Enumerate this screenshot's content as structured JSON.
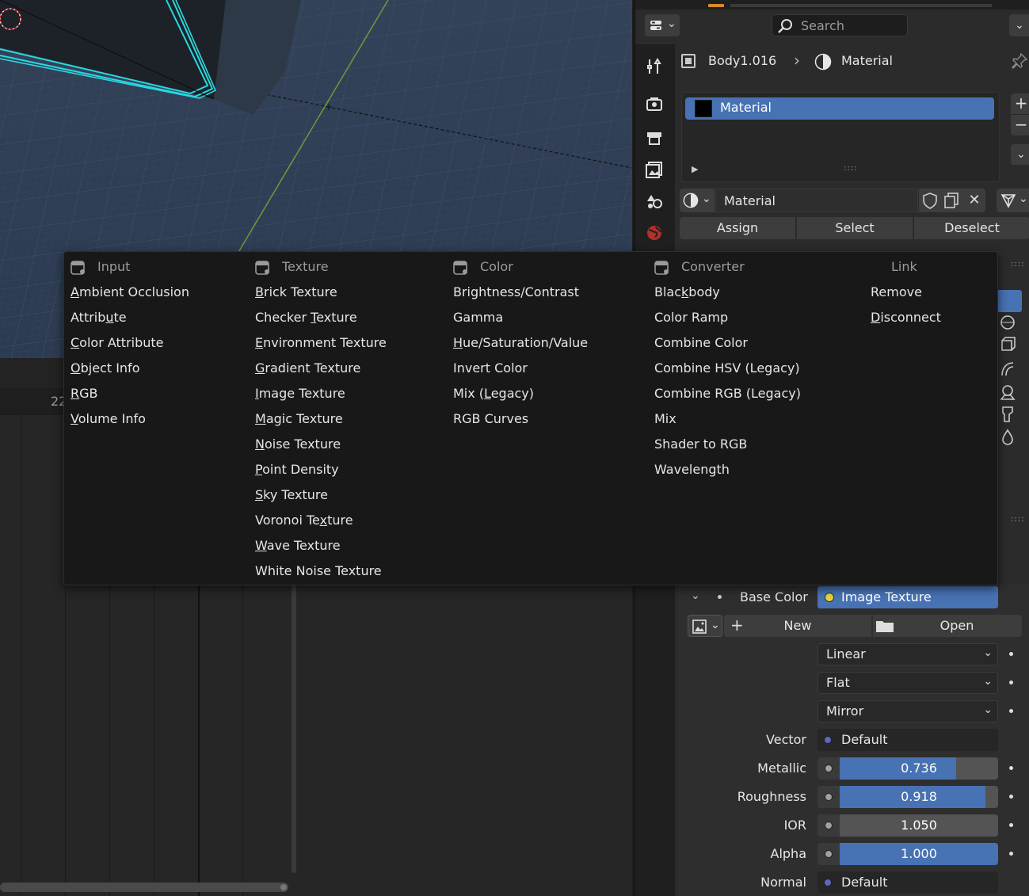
{
  "properties": {
    "search": {
      "placeholder": "Search"
    },
    "breadcrumb": {
      "object": "Body1.016",
      "material": "Material"
    },
    "material_slots": [
      {
        "label": "Material"
      }
    ],
    "material_datablock": {
      "name": "Material"
    },
    "edit_buttons": {
      "assign": "Assign",
      "select": "Select",
      "deselect": "Deselect"
    },
    "surface": {
      "base_color": {
        "label": "Base Color",
        "link": "Image Texture"
      },
      "image": {
        "new_label": "New",
        "open_label": "Open"
      },
      "interpolation": "Linear",
      "projection": "Flat",
      "extension": "Mirror",
      "vector": {
        "label": "Vector",
        "value": "Default"
      },
      "metallic": {
        "label": "Metallic",
        "value": "0.736",
        "fraction": 0.736
      },
      "roughness": {
        "label": "Roughness",
        "value": "0.918",
        "fraction": 0.918
      },
      "ior": {
        "label": "IOR",
        "value": "1.050",
        "fraction": 0.0
      },
      "alpha": {
        "label": "Alpha",
        "value": "1.000",
        "fraction": 1.0
      },
      "normal": {
        "label": "Normal",
        "value": "Default"
      }
    },
    "socket_colors": {
      "float": "#a1a1a1",
      "vector": "#6363c7",
      "color": "#c7c729"
    }
  },
  "timeline": {
    "frame_label": "22"
  },
  "add_menu": {
    "columns": [
      {
        "header": "Input",
        "icon": "node-menu-icon",
        "items": [
          {
            "pre": "",
            "key": "A",
            "post": "mbient Occlusion"
          },
          {
            "pre": "Attrib",
            "key": "u",
            "post": "te"
          },
          {
            "pre": "",
            "key": "C",
            "post": "olor Attribute"
          },
          {
            "pre": "",
            "key": "O",
            "post": "bject Info"
          },
          {
            "pre": "",
            "key": "R",
            "post": "GB"
          },
          {
            "pre": "",
            "key": "V",
            "post": "olume Info"
          }
        ]
      },
      {
        "header": "Texture",
        "icon": "node-menu-icon",
        "items": [
          {
            "pre": "",
            "key": "B",
            "post": "rick Texture"
          },
          {
            "pre": "Checker ",
            "key": "T",
            "post": "exture"
          },
          {
            "pre": "",
            "key": "E",
            "post": "nvironment Texture"
          },
          {
            "pre": "",
            "key": "G",
            "post": "radient Texture"
          },
          {
            "pre": "",
            "key": "I",
            "post": "mage Texture"
          },
          {
            "pre": "",
            "key": "M",
            "post": "agic Texture"
          },
          {
            "pre": "",
            "key": "N",
            "post": "oise Texture"
          },
          {
            "pre": "",
            "key": "P",
            "post": "oint Density"
          },
          {
            "pre": "",
            "key": "S",
            "post": "ky Texture"
          },
          {
            "pre": "Voronoi Te",
            "key": "x",
            "post": "ture"
          },
          {
            "pre": "",
            "key": "W",
            "post": "ave Texture"
          },
          {
            "pre": "White Noise Texture",
            "key": "",
            "post": ""
          }
        ]
      },
      {
        "header": "Color",
        "icon": "node-menu-icon",
        "items": [
          {
            "pre": "Brightness/Contrast",
            "key": "",
            "post": ""
          },
          {
            "pre": "Gamma",
            "key": "",
            "post": ""
          },
          {
            "pre": "",
            "key": "H",
            "post": "ue/Saturation/Value"
          },
          {
            "pre": "Invert Color",
            "key": "",
            "post": ""
          },
          {
            "pre": "Mix (",
            "key": "L",
            "post": "egacy)"
          },
          {
            "pre": "RGB Curves",
            "key": "",
            "post": ""
          }
        ]
      },
      {
        "header": "Converter",
        "icon": "node-menu-icon",
        "items": [
          {
            "pre": "Blac",
            "key": "k",
            "post": "body"
          },
          {
            "pre": "Color Ramp",
            "key": "",
            "post": ""
          },
          {
            "pre": "Combine Color",
            "key": "",
            "post": ""
          },
          {
            "pre": "Combine HSV (Legacy)",
            "key": "",
            "post": ""
          },
          {
            "pre": "Combine RGB (Legacy)",
            "key": "",
            "post": ""
          },
          {
            "pre": "Mix",
            "key": "",
            "post": ""
          },
          {
            "pre": "Shader to RGB",
            "key": "",
            "post": ""
          },
          {
            "pre": "Wavelength",
            "key": "",
            "post": ""
          }
        ]
      },
      {
        "header": "Link",
        "icon": "",
        "items": [
          {
            "pre": "Remove",
            "key": "",
            "post": ""
          },
          {
            "pre": "",
            "key": "D",
            "post": "isconnect"
          }
        ]
      }
    ]
  }
}
